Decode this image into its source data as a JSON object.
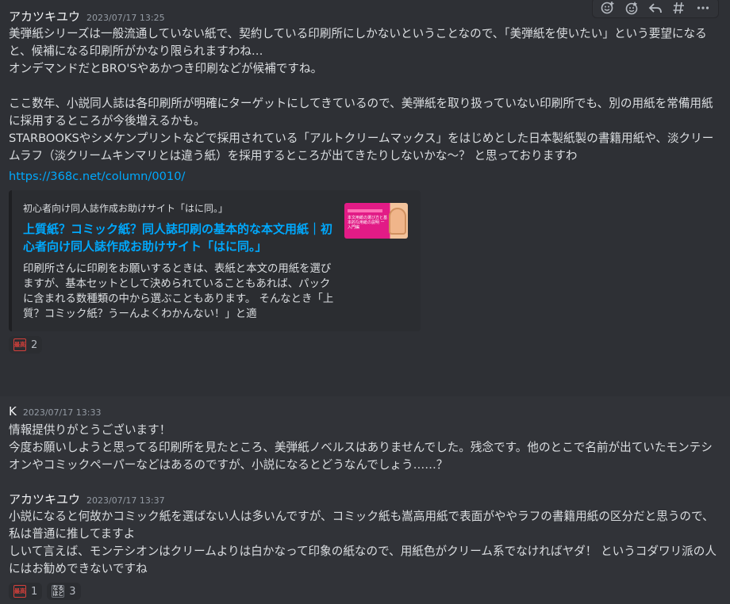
{
  "toolbar": {
    "icons": [
      "add-reaction-icon",
      "super-reaction-icon",
      "reply-icon",
      "thread-icon",
      "more-icon"
    ]
  },
  "messages": [
    {
      "author": "アカツキユウ",
      "timestamp": "2023/07/17 13:25",
      "text": "美弾紙シリーズは一般流通していない紙で、契約している印刷所にしかないということなので、「美弾紙を使いたい」という要望になると、候補になる印刷所がかなり限られますわね…\nオンデマンドだとBRO'Sやあかつき印刷などが候補ですね。\n\nここ数年、小説同人誌は各印刷所が明確にターゲットにしてきているので、美弾紙を取り扱っていない印刷所でも、別の用紙を常備用紙に採用するところが今後増えるかも。\nSTARBOOKSやシメケンプリントなどで採用されている「アルトクリームマックス」をはじめとした日本製紙製の書籍用紙や、淡クリームラフ（淡クリームキンマリとは違う紙）を採用するところが出てきたりしないかな～？ と思っておりますわ",
      "link": "https://368c.net/column/0010/",
      "embed": {
        "provider": "初心者向け同人誌作成お助けサイト「はに同。」",
        "title": "上質紙？コミック紙？同人誌印刷の基本的な本文用紙｜初心者向け同人誌作成お助けサイト「はに同。」",
        "description": "印刷所さんに印刷をお願いするときは、表紙と本文の用紙を選びますが、基本セットとして決められていることもあれば、パックに含まれる数種類の中から選ぶこともあります。 そんなとき「上質？コミック紙？うーんよくわかんない！」と適",
        "thumb_text": "本文用紙の選び方と基本的な用紙の説明 ー入門編"
      },
      "reactions": [
        {
          "emoji": "stamp-emoji",
          "glyph": "最高",
          "count": "2"
        }
      ]
    },
    {
      "author": "K",
      "timestamp": "2023/07/17 13:33",
      "text": "情報提供りがとうございます！\n今度お願いしようと思ってる印刷所を見たところ、美弾紙ノベルスはありませんでした。残念です。他のとこで名前が出ていたモンテシオンやコミックペーパーなどはあるのですが、小説になるとどうなんでしょう……？"
    },
    {
      "author": "アカツキユウ",
      "timestamp": "2023/07/17 13:37",
      "text": "小説になると何故かコミック紙を選ばない人は多いんですが、コミック紙も嵩高用紙で表面がややラフの書籍用紙の区分だと思うので、私は普通に推してますよ\nしいて言えば、モンテシオンはクリームよりは白かなって印象の紙なので、用紙色がクリーム系でなければヤダ！ というコダワリ派の人にはお勧めできないですね",
      "reactions": [
        {
          "emoji": "stamp-emoji",
          "glyph": "最高",
          "count": "1"
        },
        {
          "emoji": "text-stamp-emoji",
          "glyph": "なるほど",
          "count": "3"
        }
      ]
    }
  ]
}
